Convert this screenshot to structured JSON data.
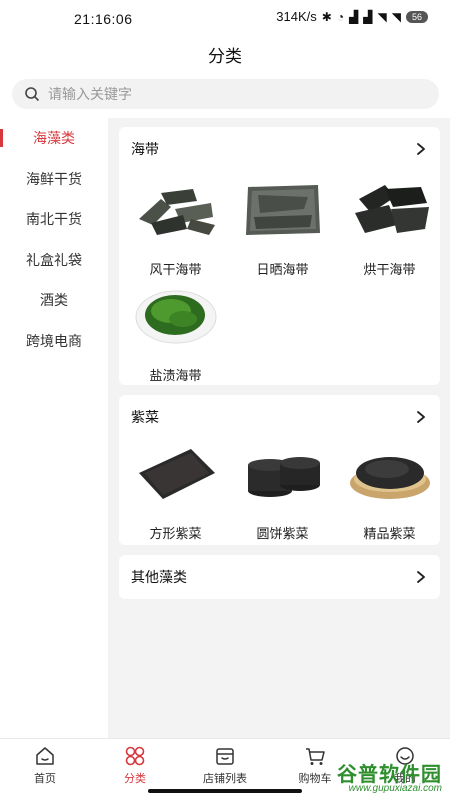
{
  "status_bar": {
    "time": "21:16:06",
    "speed": "314K/s",
    "battery": "56"
  },
  "page": {
    "title": "分类"
  },
  "search": {
    "placeholder": "请输入关键字"
  },
  "sidebar": {
    "items": [
      {
        "label": "海藻类",
        "active": true
      },
      {
        "label": "海鲜干货",
        "active": false
      },
      {
        "label": "南北干货",
        "active": false
      },
      {
        "label": "礼盒礼袋",
        "active": false
      },
      {
        "label": "酒类",
        "active": false
      },
      {
        "label": "跨境电商",
        "active": false
      }
    ]
  },
  "sections": [
    {
      "title": "海带",
      "items": [
        {
          "label": "风干海带",
          "image": "dried-kelp-image"
        },
        {
          "label": "日晒海带",
          "image": "sun-dried-kelp-image"
        },
        {
          "label": "烘干海带",
          "image": "baked-kelp-image"
        },
        {
          "label": "盐渍海带",
          "image": "salted-kelp-image"
        }
      ]
    },
    {
      "title": "紫菜",
      "items": [
        {
          "label": "方形紫菜",
          "image": "square-laver-image"
        },
        {
          "label": "圆饼紫菜",
          "image": "round-laver-image"
        },
        {
          "label": "精品紫菜",
          "image": "premium-laver-image"
        }
      ]
    },
    {
      "title": "其他藻类",
      "items": []
    }
  ],
  "bottom_nav": [
    {
      "label": "首页",
      "icon": "home-icon",
      "active": false
    },
    {
      "label": "分类",
      "icon": "grid-icon",
      "active": true
    },
    {
      "label": "店铺列表",
      "icon": "store-icon",
      "active": false
    },
    {
      "label": "购物车",
      "icon": "cart-icon",
      "active": false
    },
    {
      "label": "我的",
      "icon": "user-icon",
      "active": false
    }
  ],
  "watermark": {
    "title": "谷普软件园",
    "url": "www.gupuxiazai.com"
  },
  "colors": {
    "accent": "#d6383c",
    "content_bg": "#f3f3f3"
  }
}
